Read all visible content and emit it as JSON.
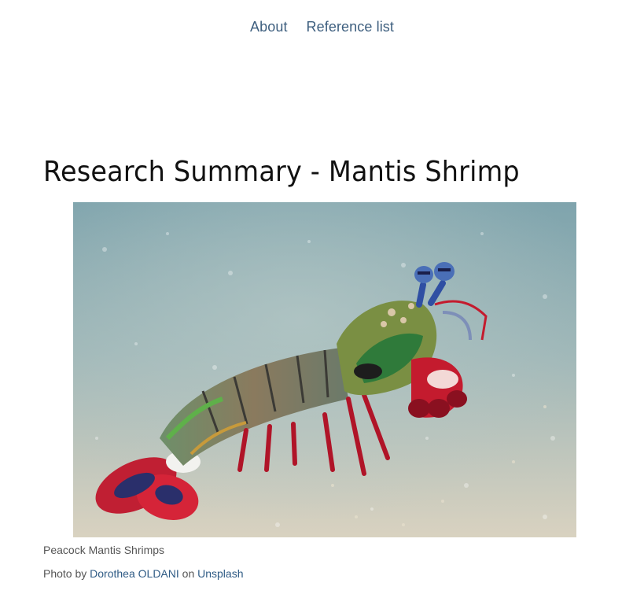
{
  "nav": {
    "items": [
      {
        "label": "About"
      },
      {
        "label": "Reference list"
      }
    ]
  },
  "page": {
    "title": "Research Summary - Mantis Shrimp"
  },
  "figure": {
    "caption": "Peacock Mantis Shrimps",
    "credit": {
      "prefix": "Photo by",
      "author": "Dorothea OLDANI",
      "middle": "on",
      "source": "Unsplash"
    }
  },
  "colors": {
    "link": "#3e5f7f",
    "heading": "#111111",
    "caption": "#555555"
  }
}
